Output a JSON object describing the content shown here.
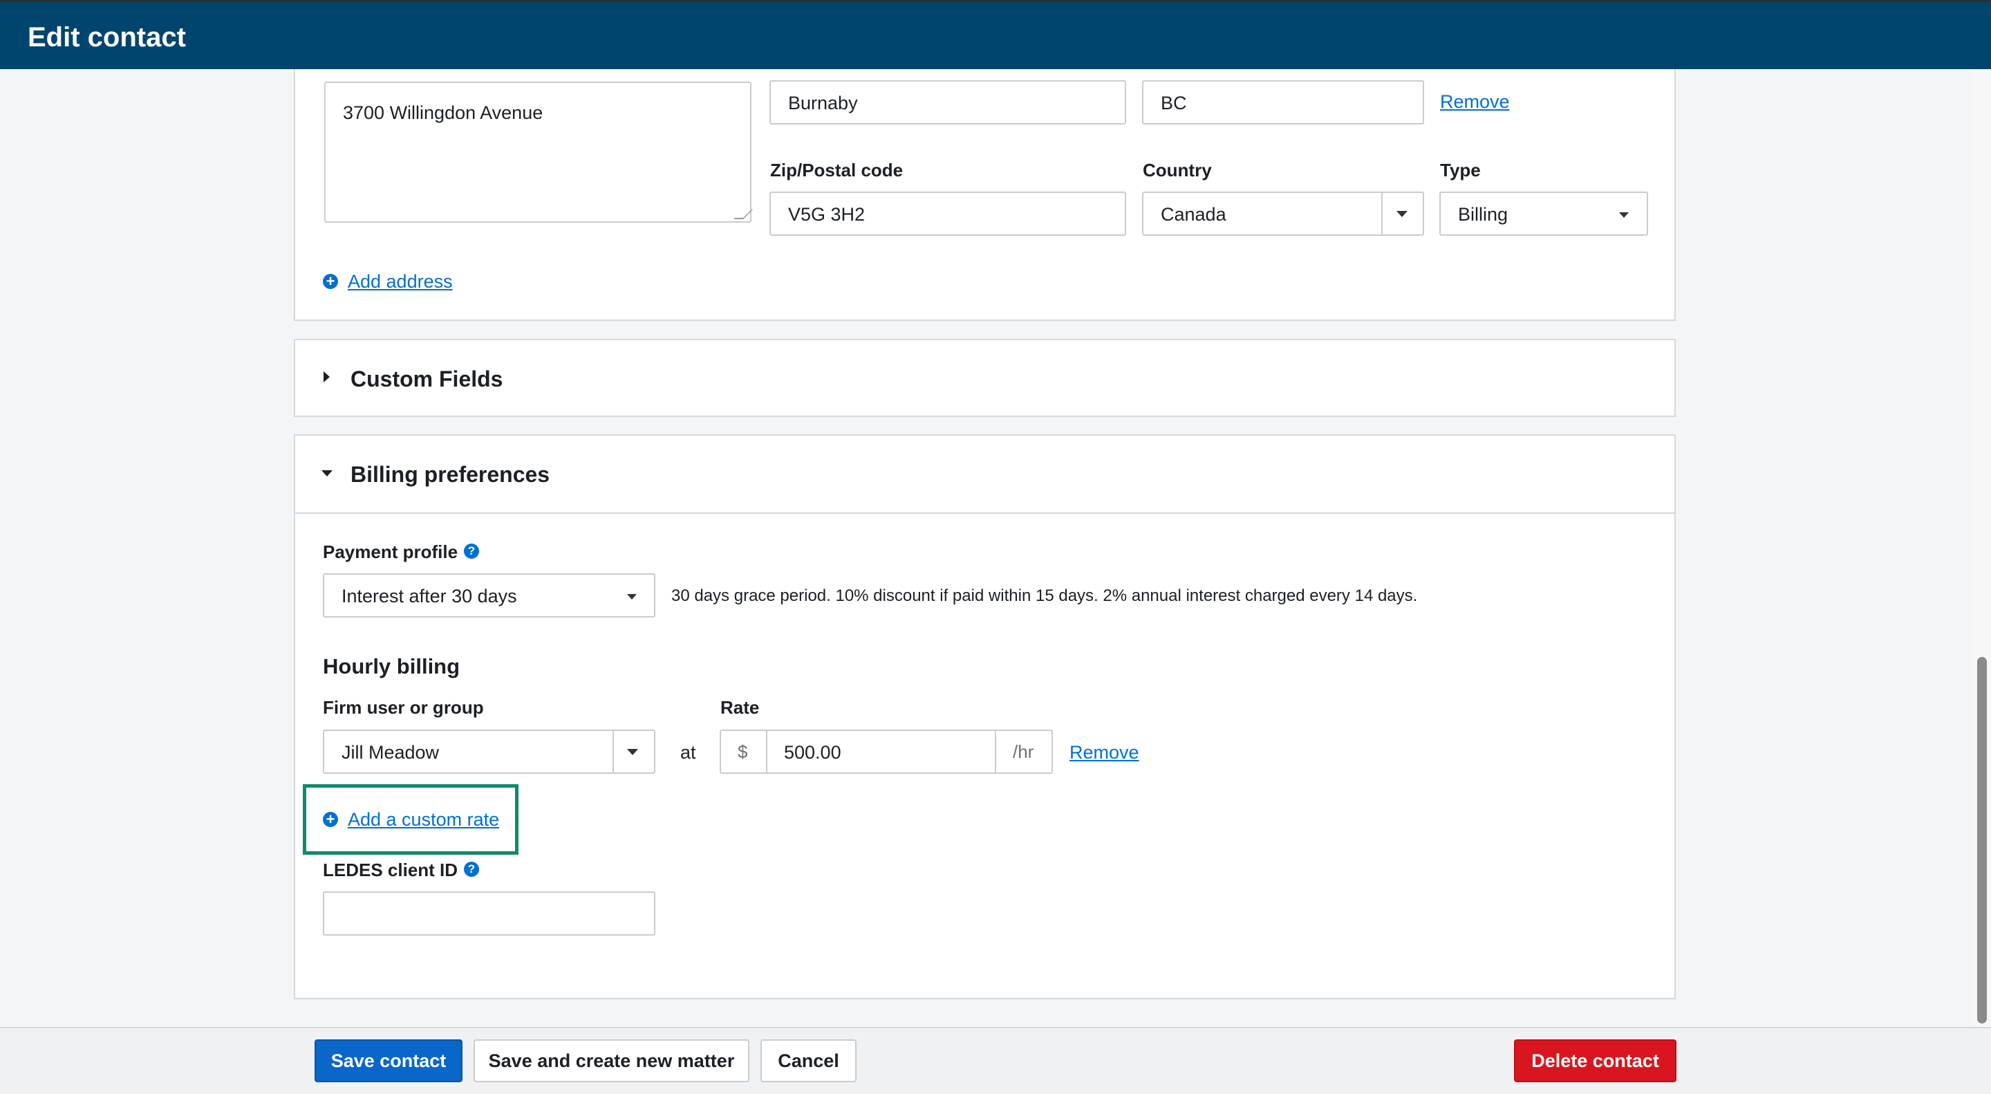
{
  "window": {
    "title": "Edit contact"
  },
  "address": {
    "street": "3700 Willingdon Avenue",
    "city": "Burnaby",
    "province": "BC",
    "remove_label": "Remove",
    "zip_label": "Zip/Postal code",
    "zip_value": "V5G 3H2",
    "country_label": "Country",
    "country_value": "Canada",
    "type_label": "Type",
    "type_value": "Billing",
    "add_address_label": "Add address"
  },
  "custom_fields": {
    "title": "Custom Fields"
  },
  "billing": {
    "title": "Billing preferences",
    "payment_profile_label": "Payment profile",
    "payment_profile_value": "Interest after 30 days",
    "payment_profile_description": "30 days grace period. 10% discount if paid within 15 days. 2% annual interest charged every 14 days.",
    "hourly_billing_heading": "Hourly billing",
    "firm_user_label": "Firm user or group",
    "firm_user_value": "Jill Meadow",
    "at_label": "at",
    "rate_label": "Rate",
    "currency_symbol": "$",
    "rate_value": "500.00",
    "rate_unit": "/hr",
    "remove_label": "Remove",
    "add_custom_rate_label": "Add a custom rate",
    "ledes_label": "LEDES client ID",
    "ledes_value": ""
  },
  "footer": {
    "save_label": "Save contact",
    "save_new_matter_label": "Save and create new matter",
    "cancel_label": "Cancel",
    "delete_label": "Delete contact"
  },
  "colors": {
    "header_bg": "#00456e",
    "link": "#0070d2",
    "primary_button": "#0a66c9",
    "danger_button": "#d9161f",
    "highlight_border": "#0f8a6c"
  }
}
